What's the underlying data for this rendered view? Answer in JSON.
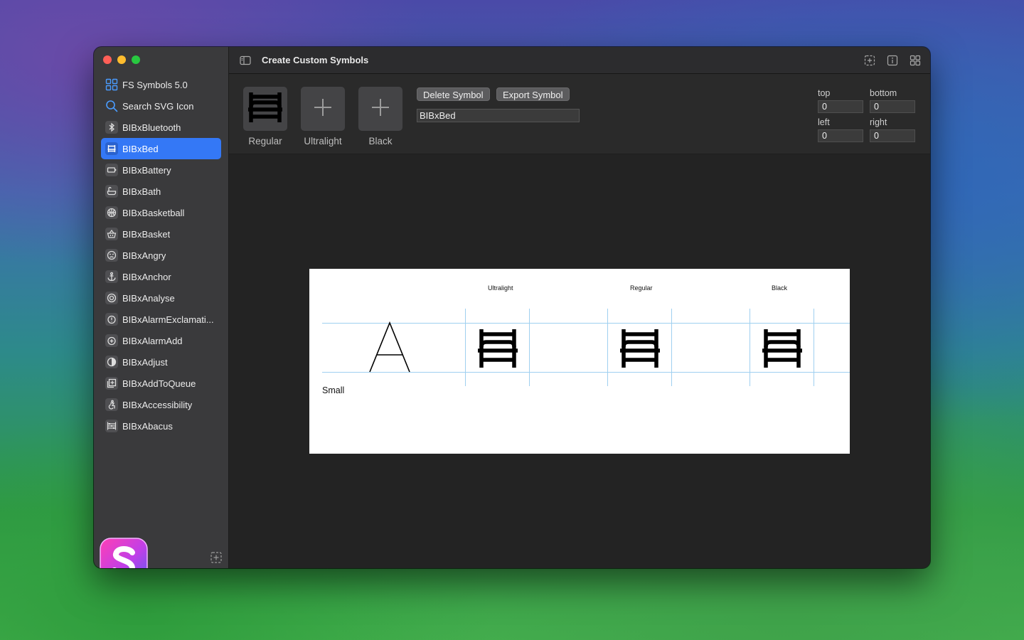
{
  "window": {
    "title": "Create Custom Symbols"
  },
  "sidebar": {
    "items": [
      {
        "label": "FS Symbols 5.0",
        "icon": "grid-icon",
        "selected": false
      },
      {
        "label": "Search SVG Icon",
        "icon": "search-icon",
        "selected": false
      },
      {
        "label": "BIBxBluetooth",
        "icon": "bluetooth-icon",
        "selected": false
      },
      {
        "label": "BIBxBed",
        "icon": "bed-icon",
        "selected": true
      },
      {
        "label": "BIBxBattery",
        "icon": "battery-icon",
        "selected": false
      },
      {
        "label": "BIBxBath",
        "icon": "bath-icon",
        "selected": false
      },
      {
        "label": "BIBxBasketball",
        "icon": "basketball-icon",
        "selected": false
      },
      {
        "label": "BIBxBasket",
        "icon": "basket-icon",
        "selected": false
      },
      {
        "label": "BIBxAngry",
        "icon": "angry-face-icon",
        "selected": false
      },
      {
        "label": "BIBxAnchor",
        "icon": "anchor-icon",
        "selected": false
      },
      {
        "label": "BIBxAnalyse",
        "icon": "analyse-icon",
        "selected": false
      },
      {
        "label": "BIBxAlarmExclamati...",
        "icon": "alarm-exclamation-icon",
        "selected": false
      },
      {
        "label": "BIBxAlarmAdd",
        "icon": "alarm-add-icon",
        "selected": false
      },
      {
        "label": "BIBxAdjust",
        "icon": "adjust-icon",
        "selected": false
      },
      {
        "label": "BIBxAddToQueue",
        "icon": "add-to-queue-icon",
        "selected": false
      },
      {
        "label": "BIBxAccessibility",
        "icon": "accessibility-icon",
        "selected": false
      },
      {
        "label": "BIBxAbacus",
        "icon": "abacus-icon",
        "selected": false
      }
    ]
  },
  "weights": [
    {
      "label": "Regular",
      "icon": "bed-icon"
    },
    {
      "label": "Ultralight",
      "icon": "plus-icon"
    },
    {
      "label": "Black",
      "icon": "plus-icon"
    }
  ],
  "actions": {
    "delete_label": "Delete Symbol",
    "export_label": "Export Symbol"
  },
  "symbol_name": "BIBxBed",
  "insets": {
    "top_label": "top",
    "top_value": "0",
    "bottom_label": "bottom",
    "bottom_value": "0",
    "left_label": "left",
    "left_value": "0",
    "right_label": "right",
    "right_value": "0"
  },
  "preview": {
    "columns": [
      "Ultralight",
      "Regular",
      "Black"
    ],
    "glyph": "A",
    "size_label": "Small"
  },
  "colors": {
    "accent": "#3478f6",
    "guide_line": "#9fd0f0"
  }
}
